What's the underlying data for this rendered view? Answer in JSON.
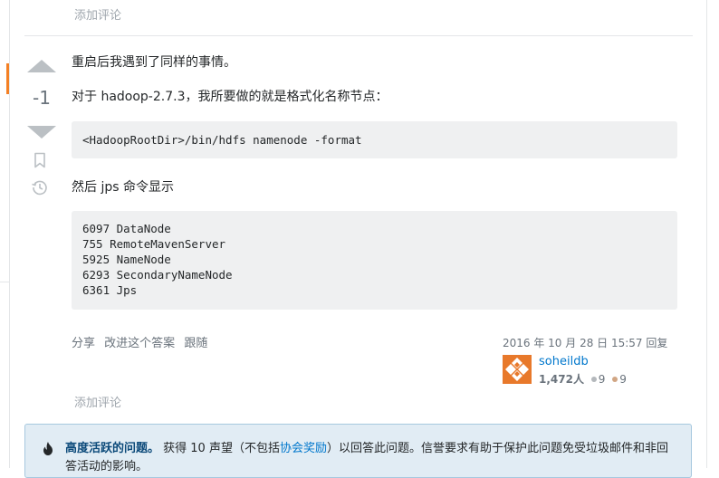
{
  "comments": {
    "top_link": "添加评论",
    "bottom_link": "添加评论"
  },
  "vote": {
    "count": "-1"
  },
  "answer": {
    "line1": "重启后我遇到了同样的事情。",
    "line2": "对于 hadoop-2.7.3，我所要做的就是格式化名称节点：",
    "code1": "<HadoopRootDir>/bin/hdfs namenode -format",
    "line3": "然后 jps 命令显示",
    "code2_lines": [
      "6097 DataNode",
      "755 RemoteMavenServer",
      "5925 NameNode",
      "6293 SecondaryNameNode",
      "6361 Jps"
    ]
  },
  "post_menu": {
    "share": "分享",
    "improve": "改进这个答案",
    "follow": "跟随"
  },
  "user": {
    "action_time": "2016 年 10 月 28 日 15:57 回复",
    "name": "soheildb",
    "reputation": "1,472人",
    "silver": "9",
    "bronze": "9",
    "avatar_color": "#e8792b"
  },
  "notice": {
    "title": "高度活跃的问题。",
    "text_part1": "获得 10 声望（不包括",
    "link": "协会奖励",
    "text_part2": "）以回答此问题。信誉要求有助于保护此问题免受垃圾邮件和非回答活动的影响。"
  },
  "colors": {
    "accent": "#f48024",
    "link": "#0077cc",
    "silver_badge": "#b4b8bc",
    "bronze_badge": "#d1a684"
  },
  "icons": [
    "up-arrow-icon",
    "down-arrow-icon",
    "bookmark-icon",
    "history-icon",
    "flame-icon"
  ]
}
